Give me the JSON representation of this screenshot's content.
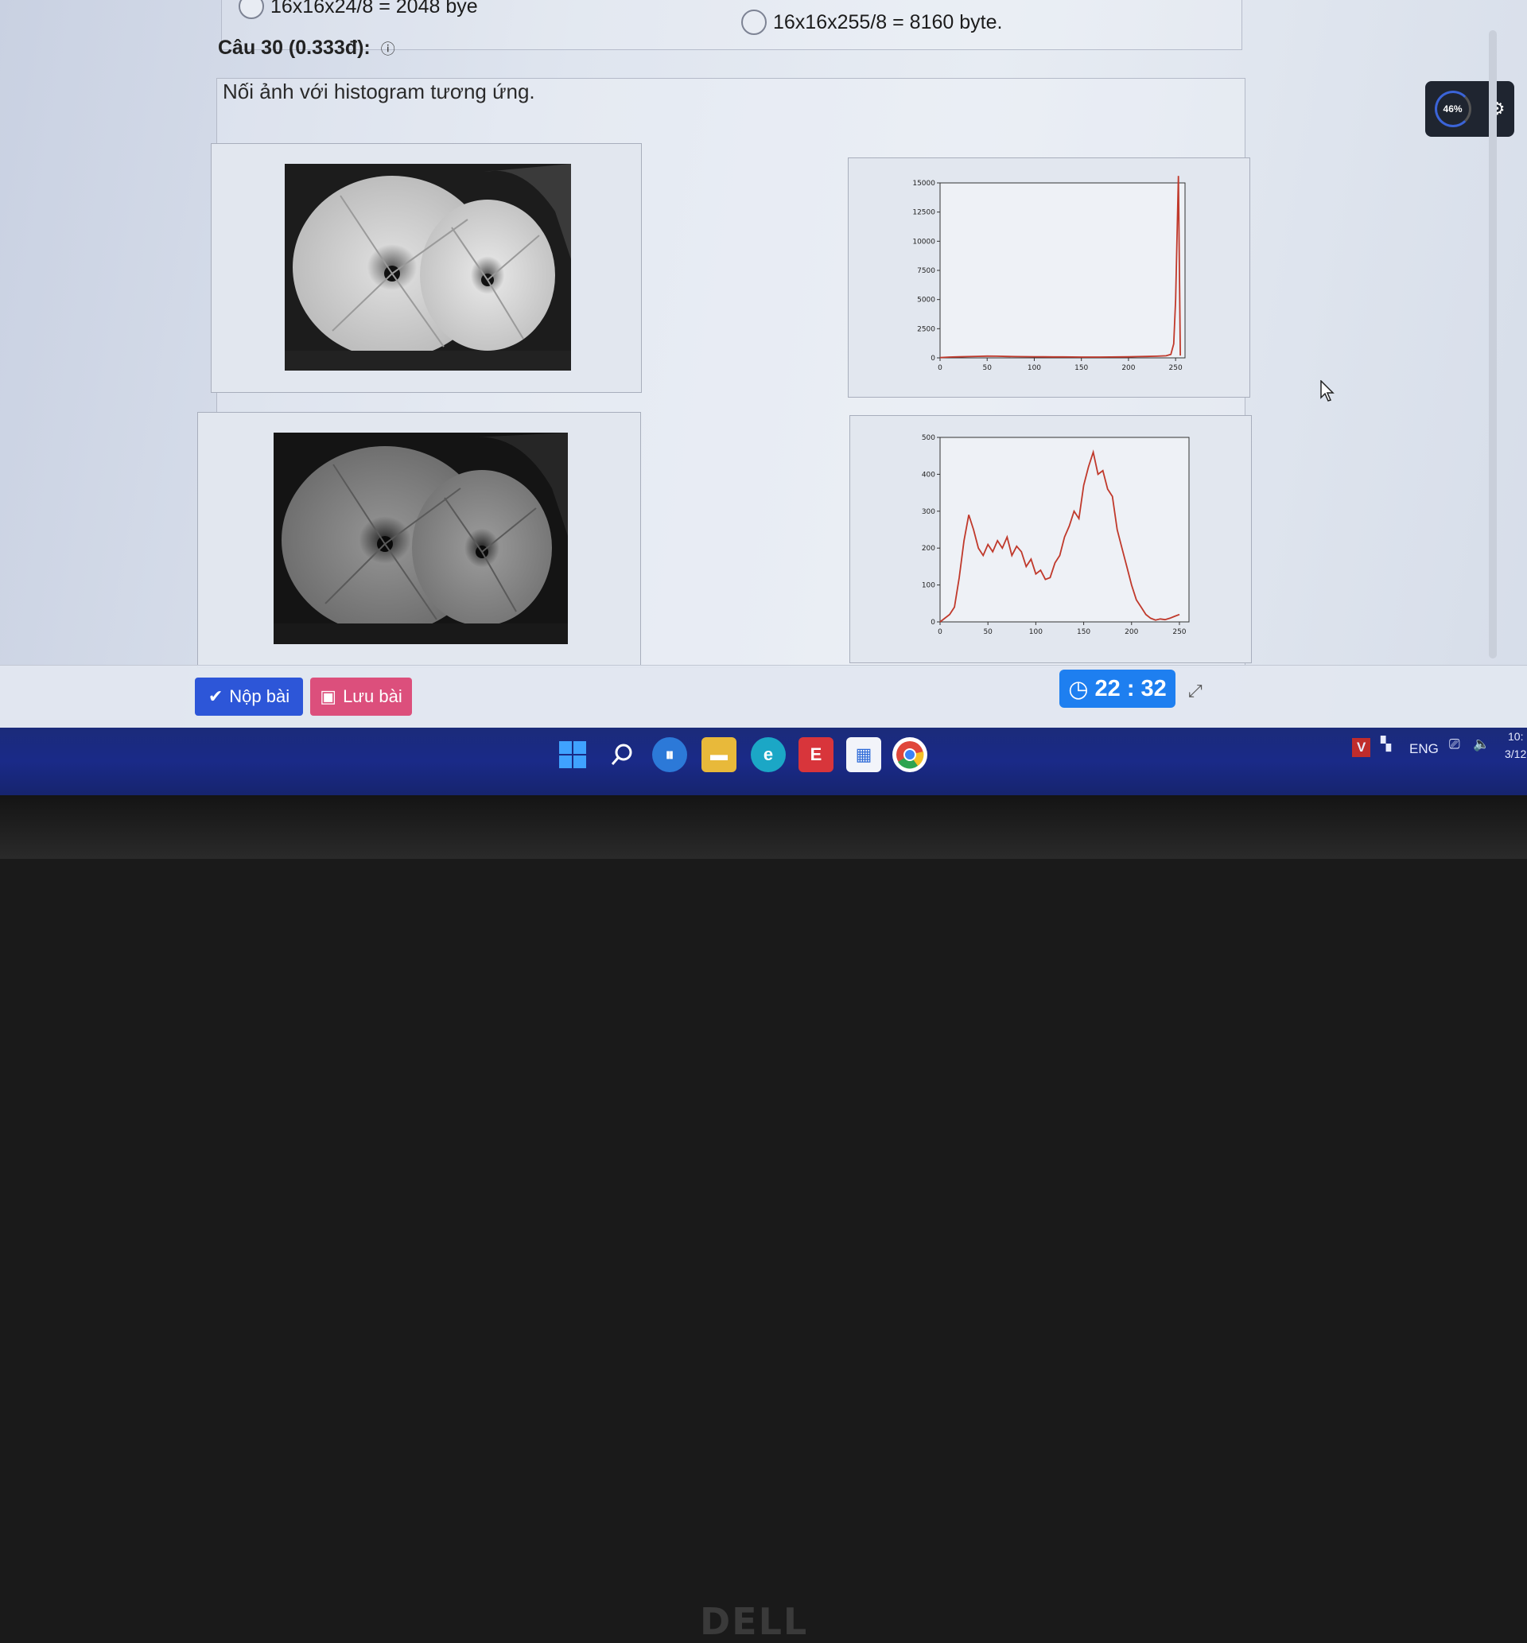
{
  "previous_question": {
    "option_left": "16x16x24/8 = 2048 bye",
    "option_right": "16x16x255/8 = 8160 byte."
  },
  "question": {
    "title": "Câu 30 (0.333đ):",
    "info_icon": "info-icon",
    "prompt": "Nối ảnh với histogram tương ứng."
  },
  "chart_data": [
    {
      "type": "line",
      "color": "#c0392b",
      "xlim": [
        0,
        260
      ],
      "ylim": [
        0,
        15000
      ],
      "xticks": [
        "0",
        "50",
        "100",
        "150",
        "200",
        "250"
      ],
      "yticks": [
        "0",
        "2500",
        "5000",
        "7500",
        "10000",
        "12500",
        "15000"
      ],
      "x": [
        0,
        10,
        20,
        30,
        40,
        50,
        60,
        70,
        80,
        90,
        100,
        110,
        120,
        130,
        140,
        150,
        160,
        170,
        180,
        190,
        200,
        210,
        220,
        230,
        240,
        245,
        248,
        250,
        252,
        253,
        255
      ],
      "y": [
        30,
        70,
        90,
        110,
        130,
        150,
        140,
        120,
        110,
        100,
        95,
        90,
        80,
        80,
        75,
        70,
        70,
        70,
        75,
        80,
        90,
        110,
        120,
        140,
        180,
        300,
        1200,
        5000,
        12000,
        16000,
        200
      ]
    },
    {
      "type": "line",
      "color": "#c0392b",
      "xlim": [
        0,
        260
      ],
      "ylim": [
        0,
        500
      ],
      "xticks": [
        "0",
        "50",
        "100",
        "150",
        "200",
        "250"
      ],
      "yticks": [
        "0",
        "100",
        "200",
        "300",
        "400",
        "500"
      ],
      "x": [
        0,
        5,
        10,
        15,
        20,
        25,
        30,
        35,
        40,
        45,
        50,
        55,
        60,
        65,
        70,
        75,
        80,
        85,
        90,
        95,
        100,
        105,
        110,
        115,
        120,
        125,
        130,
        135,
        140,
        145,
        150,
        155,
        160,
        165,
        170,
        175,
        180,
        185,
        190,
        195,
        200,
        205,
        210,
        215,
        220,
        225,
        230,
        235,
        240,
        245,
        250
      ],
      "y": [
        0,
        10,
        20,
        40,
        120,
        220,
        290,
        250,
        200,
        180,
        210,
        190,
        220,
        200,
        230,
        180,
        205,
        190,
        150,
        170,
        130,
        140,
        115,
        120,
        160,
        180,
        230,
        260,
        300,
        280,
        370,
        420,
        460,
        400,
        410,
        360,
        340,
        250,
        200,
        150,
        100,
        60,
        40,
        20,
        10,
        5,
        8,
        6,
        10,
        15,
        20
      ]
    }
  ],
  "footer": {
    "submit_label": "Nộp bài",
    "save_label": "Lưu bài",
    "timer": "22 : 32"
  },
  "overlay": {
    "percent": "46%"
  },
  "taskbar": {
    "lang": "ENG",
    "time": "10:",
    "date": "3/12"
  },
  "brand": "DELL"
}
